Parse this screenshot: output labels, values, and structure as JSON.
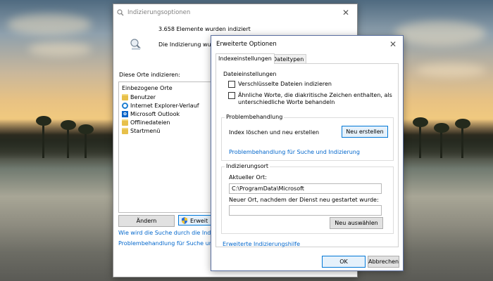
{
  "main_window": {
    "title": "Indizierungsoptionen",
    "count_text": "3.658 Elemente wurden indiziert",
    "status_text": "Die Indizierung wurde",
    "places_label": "Diese Orte indizieren:",
    "places_header": "Einbezogene Orte",
    "places": [
      {
        "label": "Benutzer",
        "icon": "folder-icon"
      },
      {
        "label": "Internet Explorer-Verlauf",
        "icon": "internet-explorer-icon"
      },
      {
        "label": "Microsoft Outlook",
        "icon": "outlook-icon"
      },
      {
        "label": "Offlinedateien",
        "icon": "folder-icon"
      },
      {
        "label": "Startmenü",
        "icon": "folder-icon"
      }
    ],
    "modify_button": "Ändern",
    "advanced_button": "Erweit",
    "link_how": "Wie wird die Suche durch die Indizierung",
    "link_troubleshoot": "Problembehandlung für Suche und Indiz"
  },
  "advanced_dialog": {
    "title": "Erweiterte Optionen",
    "tabs": [
      "Indexeinstellungen",
      "Dateitypen"
    ],
    "file_settings": {
      "title": "Dateieinstellungen",
      "option1": "Verschlüsselte Dateien indizieren",
      "option2_line1": "Ähnliche Worte, die diakritische Zeichen enthalten, als",
      "option2_line2": "unterschiedliche Worte behandeln"
    },
    "troubleshooting": {
      "title": "Problembehandlung",
      "rebuild_label": "Index löschen und neu erstellen",
      "rebuild_button": "Neu erstellen",
      "link": "Problembehandlung für Suche und Indizierung"
    },
    "index_location": {
      "title": "Indizierungsort",
      "current_label": "Aktueller Ort:",
      "current_value": "C:\\ProgramData\\Microsoft",
      "new_label": "Neuer Ort, nachdem der Dienst neu gestartet wurde:",
      "new_value": "",
      "select_button": "Neu auswählen"
    },
    "help_link": "Erweiterte Indizierungshilfe",
    "ok_button": "OK",
    "cancel_button": "Abbrechen"
  },
  "colors": {
    "link": "#0066cc",
    "accent": "#0078d7"
  }
}
